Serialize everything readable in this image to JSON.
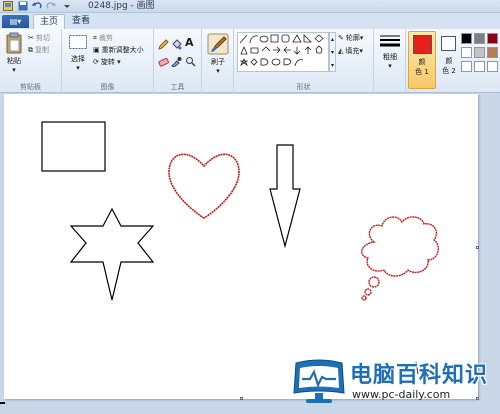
{
  "app": {
    "title": "0248.jpg - 画图"
  },
  "tabs": [
    {
      "label": "主页",
      "active": true
    },
    {
      "label": "查看",
      "active": false
    }
  ],
  "ribbon": {
    "clipboard": {
      "label": "剪贴板",
      "paste": "粘贴",
      "cut": "剪切",
      "copy": "复制"
    },
    "image": {
      "label": "图像",
      "select": "选择",
      "crop": "裁剪",
      "resize": "重新调整大小",
      "rotate": "旋转"
    },
    "tools": {
      "label": "工具"
    },
    "brushes": {
      "label": "刷子"
    },
    "shapes": {
      "label": "形状",
      "outline": "轮廓",
      "fill": "填充"
    },
    "size": {
      "label": "粗细"
    },
    "color1": {
      "label_top": "颜",
      "label_bottom": "色 1",
      "value": "#e8201c"
    },
    "color2": {
      "label_top": "颜",
      "label_bottom": "色 2",
      "value": "#ffffff"
    },
    "palette": [
      "#000000",
      "#7f7f7f",
      "#880015",
      "#ffffff",
      "#c3c3c3",
      "#b97a57",
      "#ffffff",
      "#ffffff",
      "#ffffff"
    ]
  },
  "watermark": {
    "title": "电脑百科知识",
    "url": "www.pc-daily.com"
  },
  "colors": {
    "stroke_black": "#000000",
    "stroke_red": "#c41a1a",
    "accent_blue": "#1f6fb5"
  }
}
